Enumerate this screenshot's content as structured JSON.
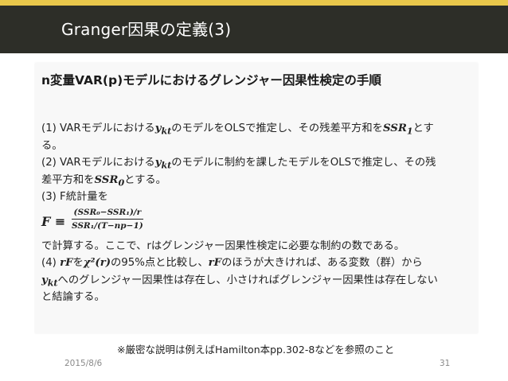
{
  "slide": {
    "title": "Granger因果の定義(3)",
    "accent_color": "#e9c74b",
    "header_color": "#2d2e28"
  },
  "box": {
    "heading": "n変量VAR(p)モデルにおけるグレンジャー因果性検定の手順",
    "step1_a": "(1) VARモデルにおける",
    "step1_var": "y",
    "step1_sub": "kt",
    "step1_b": "のモデルをOLSで推定し、その残差平方和を",
    "step1_ssr": "SSR",
    "step1_ssr_sub": "1",
    "step1_c": "とす",
    "step1_d": "る。",
    "step2_a": "(2) VARモデルにおける",
    "step2_b": "のモデルに制約を課したモデルをOLSで推定し、その残",
    "step2_c": "差平方和を",
    "step2_ssr": "SSR",
    "step2_ssr_sub": "0",
    "step2_d": "とする。",
    "step3_a": "(3) F統計量を",
    "formula_lhs": "F ≡",
    "formula_num": "(SSR₀−SSR₁)/r",
    "formula_den": "SSR₁/(T−np−1)",
    "step3_b": "で計算する。ここで、rはグレンジャー因果性検定に必要な制約の数である。",
    "step4_a": "(4)",
    "step4_rF": "rF",
    "step4_b": "を",
    "step4_chi": "χ²(r)",
    "step4_c": "の95%点と比較し、",
    "step4_rF2": "rF",
    "step4_d": "のほうが大きければ、ある変数（群）から",
    "step4_e": "へのグレンジャー因果性は存在し、小さければグレンジャー因果性は存在しない",
    "step4_f": "と結論する。"
  },
  "note": "※厳密な説明は例えばHamilton本pp.302-8などを参照のこと",
  "footer": {
    "date": "2015/8/6",
    "page": "31"
  }
}
